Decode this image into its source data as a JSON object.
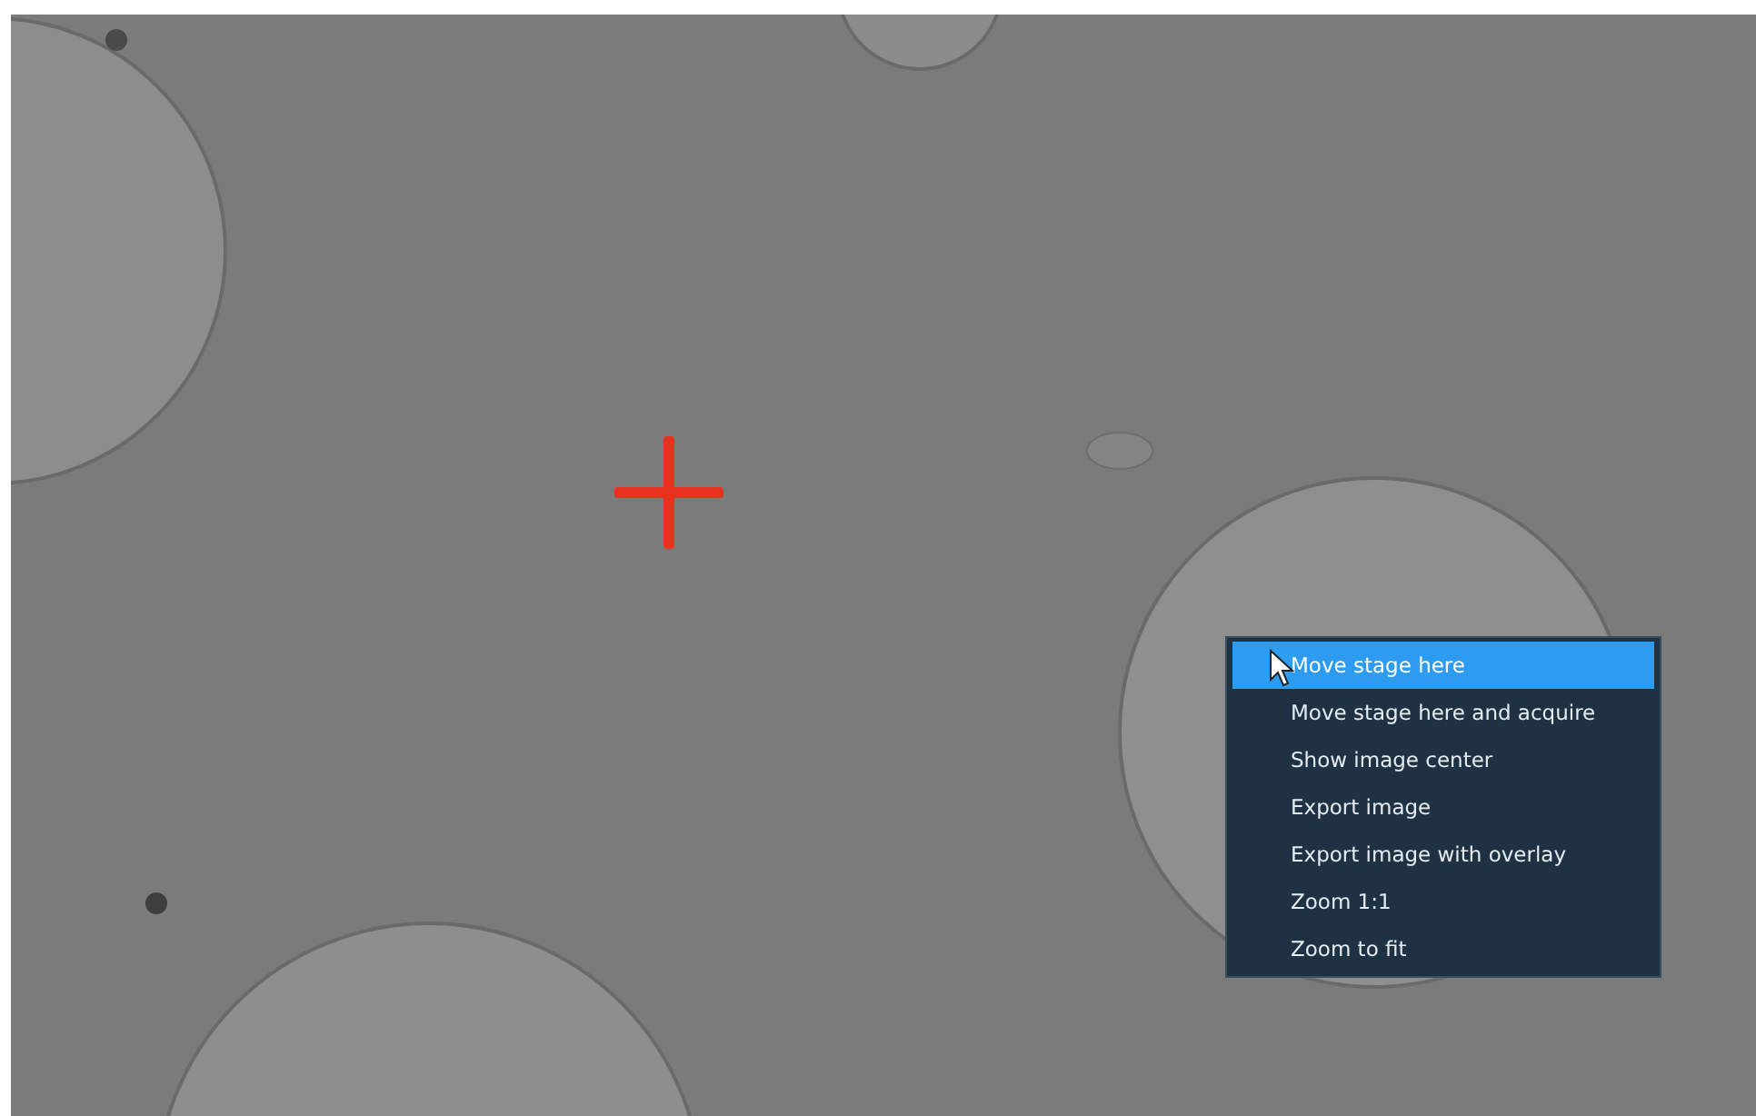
{
  "context_menu": {
    "items": [
      {
        "label": "Move stage here",
        "selected": true
      },
      {
        "label": "Move stage here and acquire",
        "selected": false
      },
      {
        "label": "Show image center",
        "selected": false
      },
      {
        "label": "Export image",
        "selected": false
      },
      {
        "label": "Export image with overlay",
        "selected": false
      },
      {
        "label": "Zoom 1:1",
        "selected": false
      },
      {
        "label": "Zoom to fit",
        "selected": false
      }
    ]
  }
}
